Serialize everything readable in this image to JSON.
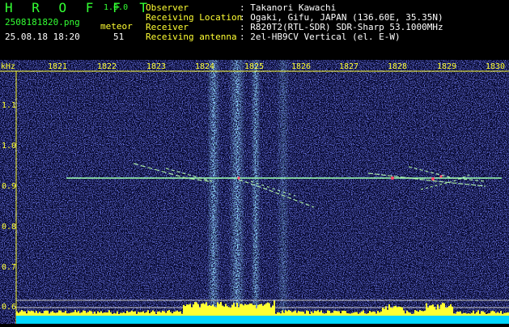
{
  "app": {
    "name": "H R O F F T",
    "version": "1.0.0"
  },
  "file": {
    "name": "2508181820.png",
    "datetime": "25.08.18 18:20"
  },
  "meteor": {
    "label": "meteor",
    "count": "51"
  },
  "info": [
    {
      "label": "Observer",
      "value": ": Takanori Kawachi"
    },
    {
      "label": "Receiving Location",
      "value": ": Ogaki, Gifu, JAPAN (136.60E, 35.35N)"
    },
    {
      "label": "Receiver",
      "value": ": R820T2(RTL-SDR) SDR-Sharp 53.1000MHz"
    },
    {
      "label": "Receiving antenna",
      "value": ": 2el-HB9CV Vertical (el. E-W)"
    }
  ],
  "axes": {
    "y_unit": "kHz",
    "x_ticks": [
      "1821",
      "1822",
      "1823",
      "1824",
      "1825",
      "1826",
      "1827",
      "1828",
      "1829",
      "1830"
    ],
    "y_ticks": [
      "1.1",
      "1.0",
      "0.9",
      "0.8",
      "0.7",
      "0.6"
    ]
  },
  "colors": {
    "background": "#06082e",
    "noise": "#2f39d6",
    "band": "#4fa8ff",
    "carrier": "#9cffb0",
    "text_green": "#33ff33",
    "text_yellow": "#ffff33",
    "baseline": "#00d7ff"
  }
}
